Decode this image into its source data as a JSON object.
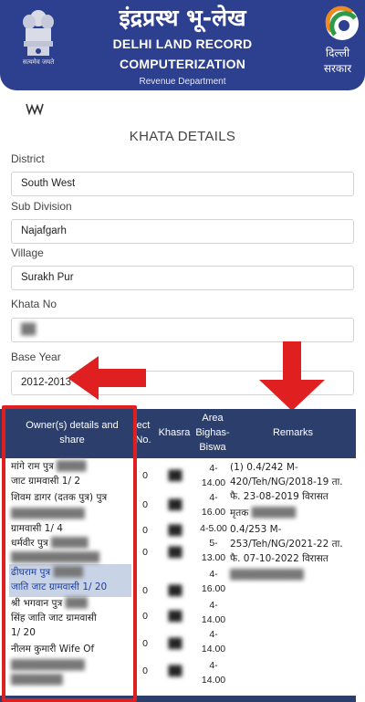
{
  "header": {
    "emblem_caption": "सत्यमेव जयते",
    "title_hindi": "इंद्रप्रस्थ भू-लेख",
    "subtitle_line1": "DELHI LAND RECORD",
    "subtitle_line2": "COMPUTERIZATION",
    "department": "Revenue Department",
    "gov_name": "दिल्ली सरकार",
    "colors": {
      "band": "#2d3f8f",
      "table_header": "#2c3e6b",
      "annotation": "#e02020"
    }
  },
  "page_title": "KHATA DETAILS",
  "form": {
    "district_label": "District",
    "district_value": "South West",
    "subdivision_label": "Sub Division",
    "subdivision_value": "Najafgarh",
    "village_label": "Village",
    "village_value": "Surakh Pur",
    "khata_label": "Khata No",
    "khata_value": "",
    "base_year_label": "Base Year",
    "base_year_value": "2012-2013"
  },
  "table": {
    "headers": {
      "owner": "Owner(s) details and share",
      "rect": "ect No.",
      "khasra": "Khasra",
      "area": "Area Bighas- Biswa",
      "remarks": "Remarks"
    },
    "owner_lines": [
      "मांगे राम पुत्र",
      "जाट ग्रामवासी 1/ 2",
      "शिवम डागर (दतक पुत्र) पुत्र",
      "ग्रामवासी 1/ 4",
      "धर्मवीर पुत्र",
      "ढीघराम पुत्र",
      "जाति जाट ग्रामवासी 1/ 20",
      "श्री भगवान पुत्र",
      "सिंह जाति जाट ग्रामवासी",
      "1/ 20",
      "नीलम कुमारी Wife Of"
    ],
    "rect_values": [
      "0",
      "0",
      "0",
      "0",
      "0",
      "0",
      "0",
      "0"
    ],
    "area_values": [
      "4-",
      "14.00",
      "4-",
      "16.00",
      "4-5.00",
      "5-",
      "13.00",
      "4-",
      "16.00",
      "4-",
      "14.00",
      "4-",
      "14.00",
      "4-",
      "14.00"
    ],
    "remarks_lines": [
      "(1) 0.4/242 M-",
      "420/Teh/NG/2018-19 ता.",
      "फै. 23-08-2019 विरासत",
      "मृतक",
      "0.4/253 M-",
      "253/Teh/NG/2021-22 ता.",
      "फै. 07-10-2022 विरासत"
    ]
  }
}
